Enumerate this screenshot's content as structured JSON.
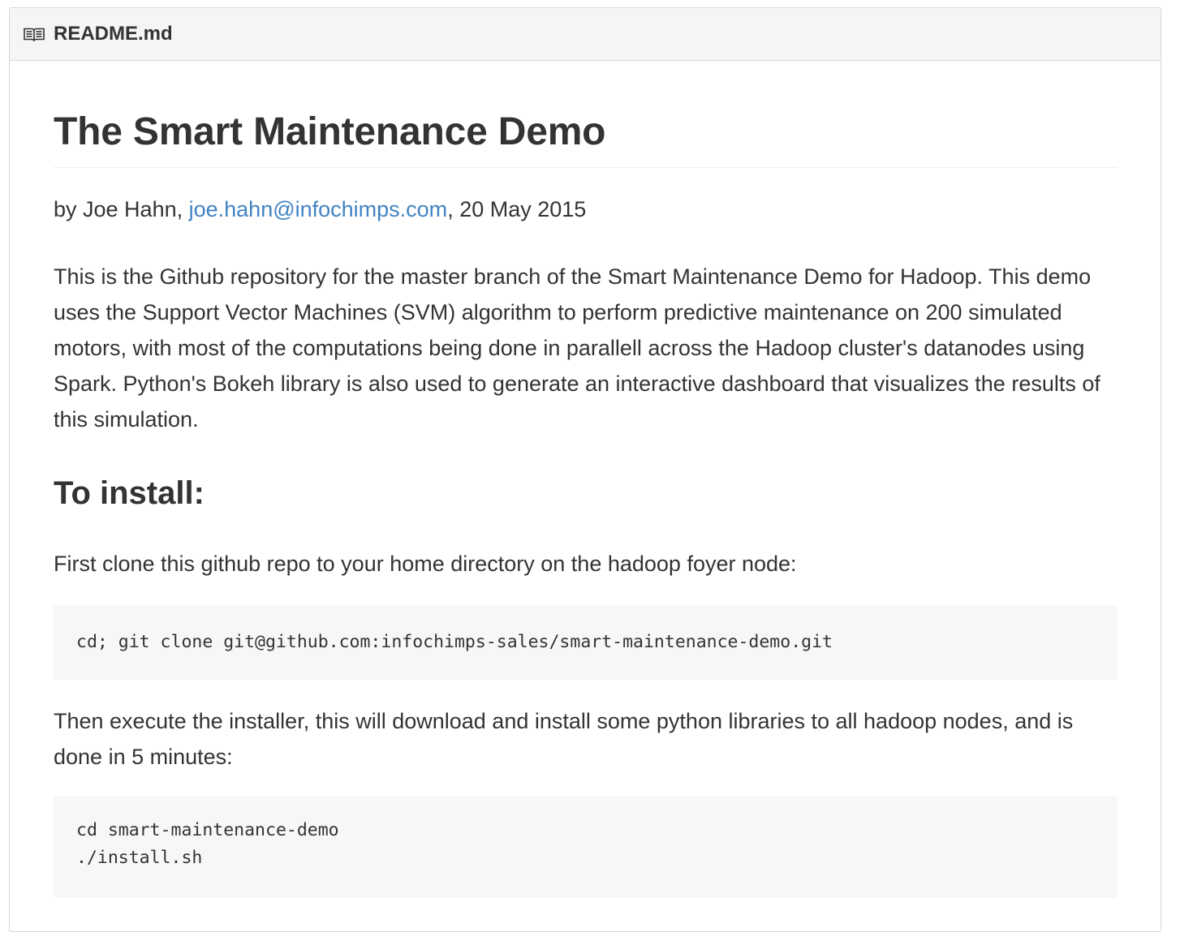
{
  "header": {
    "icon": "book-icon",
    "filename": "README.md"
  },
  "readme": {
    "title": "The Smart Maintenance Demo",
    "byline": {
      "prefix": "by Joe Hahn, ",
      "email": "joe.hahn@infochimps.com",
      "suffix": ", 20 May 2015"
    },
    "intro": "This is the Github repository for the master branch of the Smart Maintenance Demo for Hadoop. This demo uses the Support Vector Machines (SVM) algorithm to perform predictive maintenance on 200 simulated motors, with most of the computations being done in parallell across the Hadoop cluster's datanodes using Spark. Python's Bokeh library is also used to generate an interactive dashboard that visualizes the results of this simulation.",
    "install_heading": "To install:",
    "clone_text": "First clone this github repo to your home directory on the hadoop foyer node:",
    "clone_code": "cd; git clone git@github.com:infochimps-sales/smart-maintenance-demo.git",
    "installer_text": "Then execute the installer, this will download and install some python libraries to all hadoop nodes, and is done in 5 minutes:",
    "install_code": [
      "cd smart-maintenance-demo",
      "./install.sh"
    ]
  },
  "colors": {
    "link": "#4183c4",
    "text": "#333333",
    "header_bg": "#f5f5f5",
    "code_bg": "#f7f7f7",
    "border": "#d8d8d8"
  }
}
